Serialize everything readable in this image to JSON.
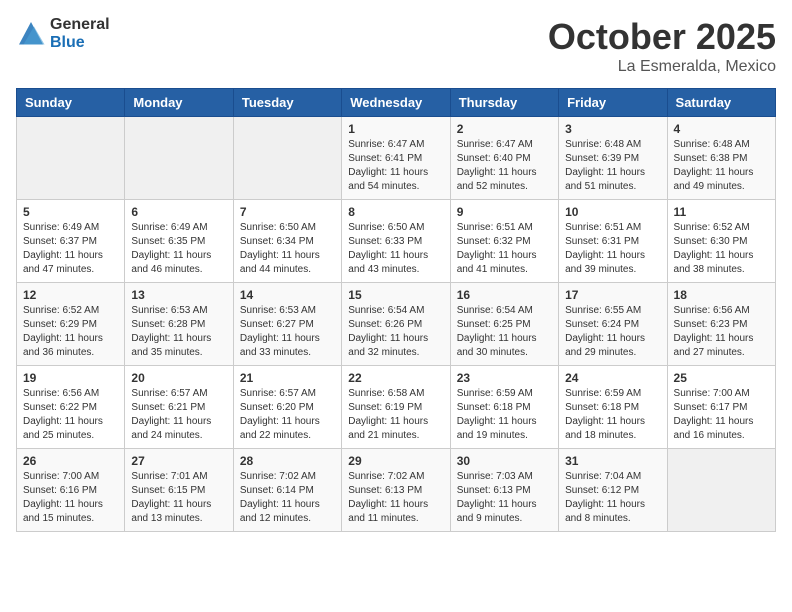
{
  "header": {
    "logo_general": "General",
    "logo_blue": "Blue",
    "title": "October 2025",
    "location": "La Esmeralda, Mexico"
  },
  "weekdays": [
    "Sunday",
    "Monday",
    "Tuesday",
    "Wednesday",
    "Thursday",
    "Friday",
    "Saturday"
  ],
  "weeks": [
    [
      {
        "day": "",
        "info": ""
      },
      {
        "day": "",
        "info": ""
      },
      {
        "day": "",
        "info": ""
      },
      {
        "day": "1",
        "info": "Sunrise: 6:47 AM\nSunset: 6:41 PM\nDaylight: 11 hours and 54 minutes."
      },
      {
        "day": "2",
        "info": "Sunrise: 6:47 AM\nSunset: 6:40 PM\nDaylight: 11 hours and 52 minutes."
      },
      {
        "day": "3",
        "info": "Sunrise: 6:48 AM\nSunset: 6:39 PM\nDaylight: 11 hours and 51 minutes."
      },
      {
        "day": "4",
        "info": "Sunrise: 6:48 AM\nSunset: 6:38 PM\nDaylight: 11 hours and 49 minutes."
      }
    ],
    [
      {
        "day": "5",
        "info": "Sunrise: 6:49 AM\nSunset: 6:37 PM\nDaylight: 11 hours and 47 minutes."
      },
      {
        "day": "6",
        "info": "Sunrise: 6:49 AM\nSunset: 6:35 PM\nDaylight: 11 hours and 46 minutes."
      },
      {
        "day": "7",
        "info": "Sunrise: 6:50 AM\nSunset: 6:34 PM\nDaylight: 11 hours and 44 minutes."
      },
      {
        "day": "8",
        "info": "Sunrise: 6:50 AM\nSunset: 6:33 PM\nDaylight: 11 hours and 43 minutes."
      },
      {
        "day": "9",
        "info": "Sunrise: 6:51 AM\nSunset: 6:32 PM\nDaylight: 11 hours and 41 minutes."
      },
      {
        "day": "10",
        "info": "Sunrise: 6:51 AM\nSunset: 6:31 PM\nDaylight: 11 hours and 39 minutes."
      },
      {
        "day": "11",
        "info": "Sunrise: 6:52 AM\nSunset: 6:30 PM\nDaylight: 11 hours and 38 minutes."
      }
    ],
    [
      {
        "day": "12",
        "info": "Sunrise: 6:52 AM\nSunset: 6:29 PM\nDaylight: 11 hours and 36 minutes."
      },
      {
        "day": "13",
        "info": "Sunrise: 6:53 AM\nSunset: 6:28 PM\nDaylight: 11 hours and 35 minutes."
      },
      {
        "day": "14",
        "info": "Sunrise: 6:53 AM\nSunset: 6:27 PM\nDaylight: 11 hours and 33 minutes."
      },
      {
        "day": "15",
        "info": "Sunrise: 6:54 AM\nSunset: 6:26 PM\nDaylight: 11 hours and 32 minutes."
      },
      {
        "day": "16",
        "info": "Sunrise: 6:54 AM\nSunset: 6:25 PM\nDaylight: 11 hours and 30 minutes."
      },
      {
        "day": "17",
        "info": "Sunrise: 6:55 AM\nSunset: 6:24 PM\nDaylight: 11 hours and 29 minutes."
      },
      {
        "day": "18",
        "info": "Sunrise: 6:56 AM\nSunset: 6:23 PM\nDaylight: 11 hours and 27 minutes."
      }
    ],
    [
      {
        "day": "19",
        "info": "Sunrise: 6:56 AM\nSunset: 6:22 PM\nDaylight: 11 hours and 25 minutes."
      },
      {
        "day": "20",
        "info": "Sunrise: 6:57 AM\nSunset: 6:21 PM\nDaylight: 11 hours and 24 minutes."
      },
      {
        "day": "21",
        "info": "Sunrise: 6:57 AM\nSunset: 6:20 PM\nDaylight: 11 hours and 22 minutes."
      },
      {
        "day": "22",
        "info": "Sunrise: 6:58 AM\nSunset: 6:19 PM\nDaylight: 11 hours and 21 minutes."
      },
      {
        "day": "23",
        "info": "Sunrise: 6:59 AM\nSunset: 6:18 PM\nDaylight: 11 hours and 19 minutes."
      },
      {
        "day": "24",
        "info": "Sunrise: 6:59 AM\nSunset: 6:18 PM\nDaylight: 11 hours and 18 minutes."
      },
      {
        "day": "25",
        "info": "Sunrise: 7:00 AM\nSunset: 6:17 PM\nDaylight: 11 hours and 16 minutes."
      }
    ],
    [
      {
        "day": "26",
        "info": "Sunrise: 7:00 AM\nSunset: 6:16 PM\nDaylight: 11 hours and 15 minutes."
      },
      {
        "day": "27",
        "info": "Sunrise: 7:01 AM\nSunset: 6:15 PM\nDaylight: 11 hours and 13 minutes."
      },
      {
        "day": "28",
        "info": "Sunrise: 7:02 AM\nSunset: 6:14 PM\nDaylight: 11 hours and 12 minutes."
      },
      {
        "day": "29",
        "info": "Sunrise: 7:02 AM\nSunset: 6:13 PM\nDaylight: 11 hours and 11 minutes."
      },
      {
        "day": "30",
        "info": "Sunrise: 7:03 AM\nSunset: 6:13 PM\nDaylight: 11 hours and 9 minutes."
      },
      {
        "day": "31",
        "info": "Sunrise: 7:04 AM\nSunset: 6:12 PM\nDaylight: 11 hours and 8 minutes."
      },
      {
        "day": "",
        "info": ""
      }
    ]
  ]
}
